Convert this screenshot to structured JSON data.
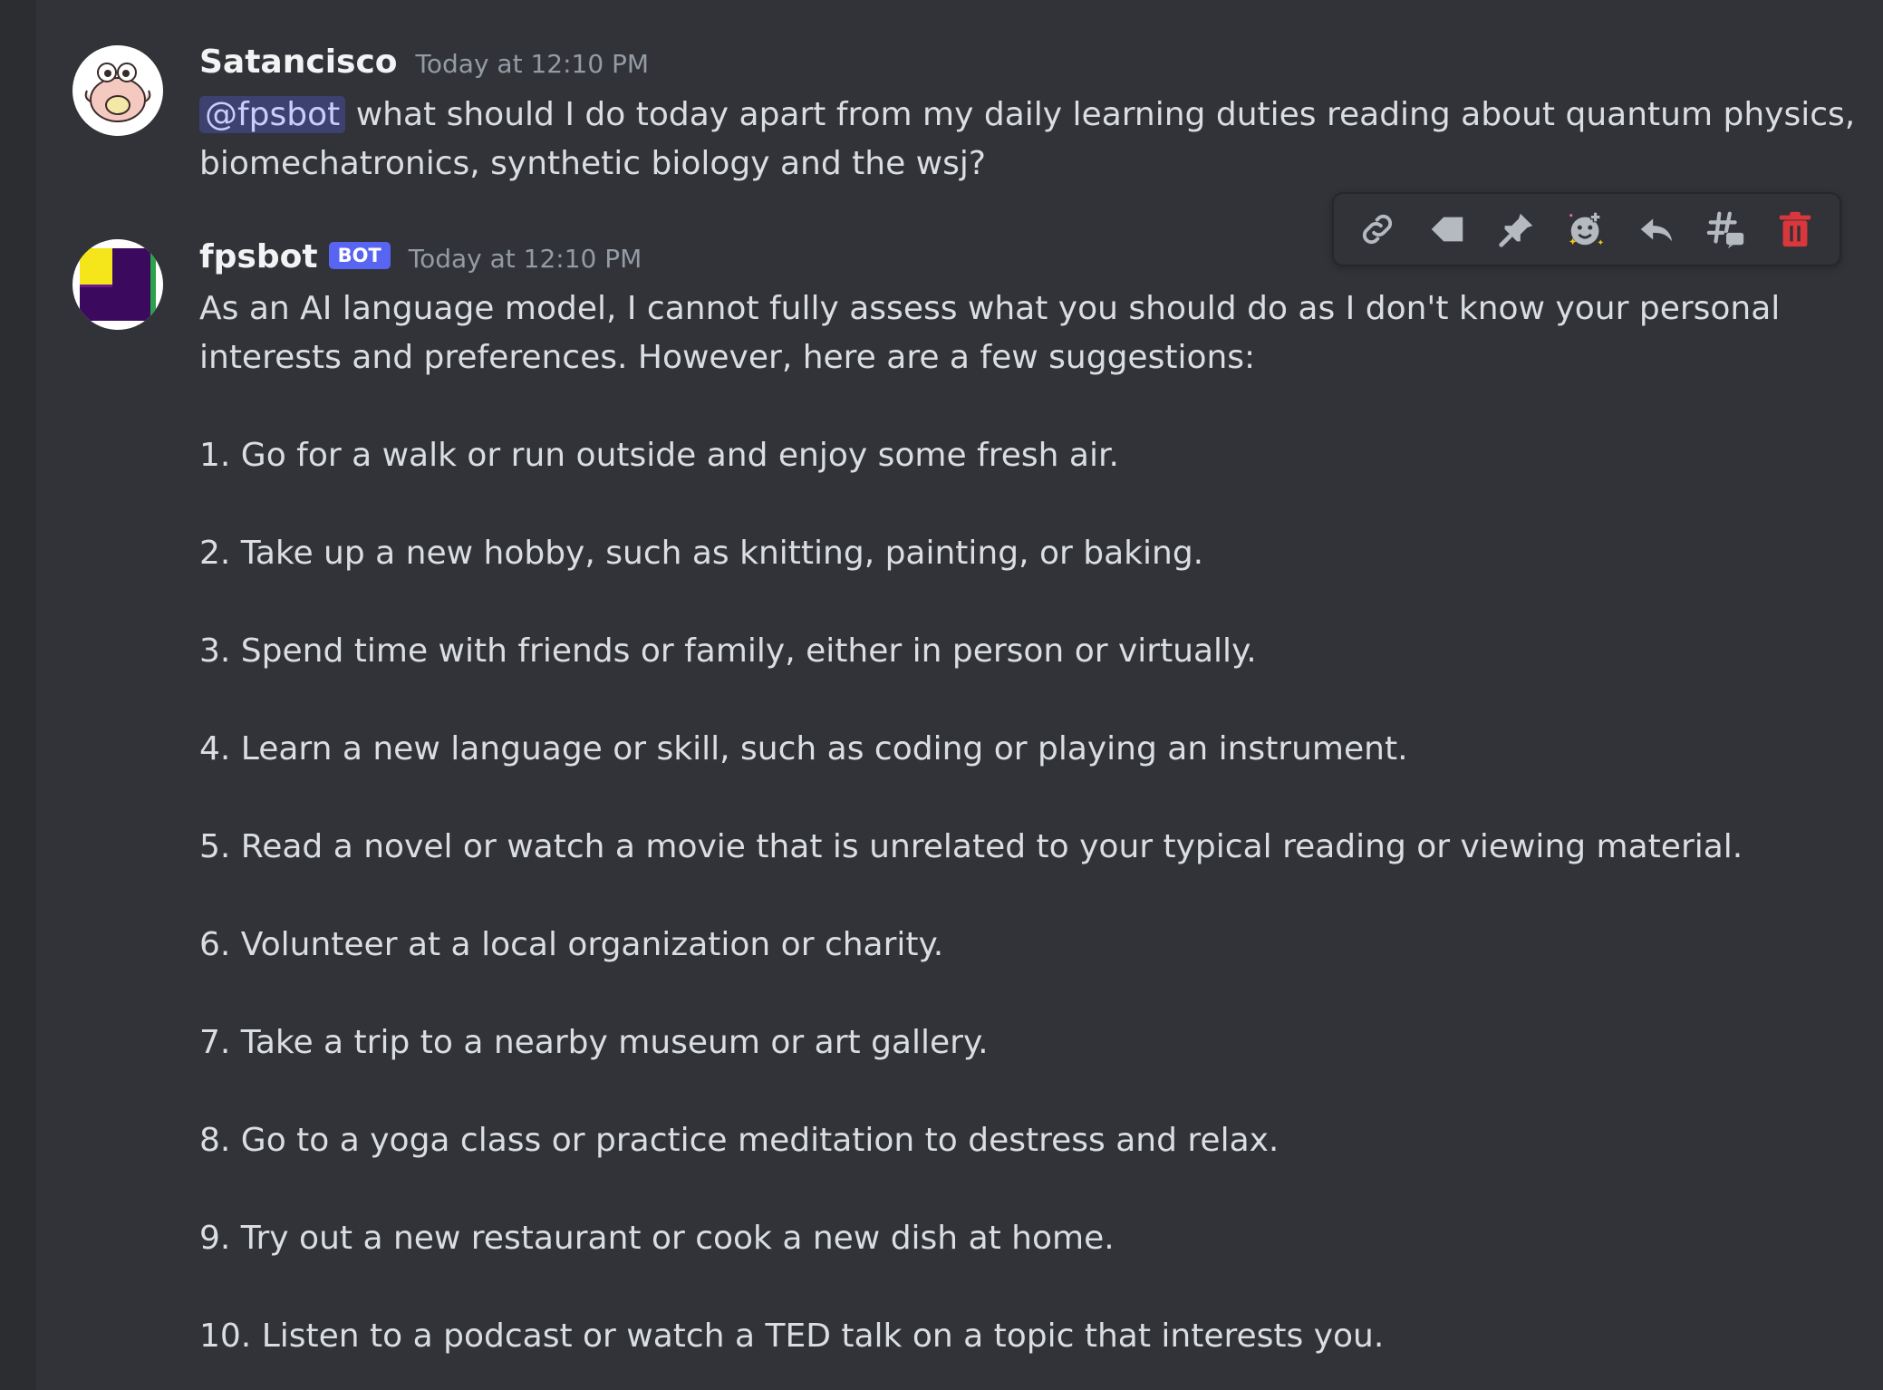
{
  "theme": {
    "background": "#313338",
    "mention_bg": "#5865f2",
    "bot_badge": "#5865f2",
    "delete_color": "#da373c"
  },
  "messages": [
    {
      "username": "Satancisco",
      "timestamp": "Today at 12:10 PM",
      "mention": "@fpsbot",
      "line1": "what should I do today apart from my daily learning duties reading about quantum physics,",
      "line2": "biomechatronics, synthetic biology and the wsj?"
    },
    {
      "username": "fpsbot",
      "badge": "BOT",
      "timestamp": "Today at 12:10 PM",
      "intro_line1": "As an AI language model, I cannot fully assess what you should do as I don't know your personal",
      "intro_line2": "interests and preferences. However, here are a few suggestions:",
      "items": [
        "1. Go for a walk or run outside and enjoy some fresh air.",
        "2. Take up a new hobby, such as knitting, painting, or baking.",
        "3. Spend time with friends or family, either in person or virtually.",
        "4. Learn a new language or skill, such as coding or playing an instrument.",
        "5. Read a novel or watch a movie that is unrelated to your typical reading or viewing material.",
        "6. Volunteer at a local organization or charity.",
        "7. Take a trip to a nearby museum or art gallery.",
        "8. Go to a yoga class or practice meditation to destress and relax.",
        "9. Try out a new restaurant or cook a new dish at home.",
        "10. Listen to a podcast or watch a TED talk on a topic that interests you."
      ]
    }
  ],
  "toolbar": {
    "icons": [
      "link-icon",
      "tag-icon",
      "pin-icon",
      "add-reaction-icon",
      "reply-icon",
      "create-thread-icon",
      "delete-icon"
    ]
  }
}
